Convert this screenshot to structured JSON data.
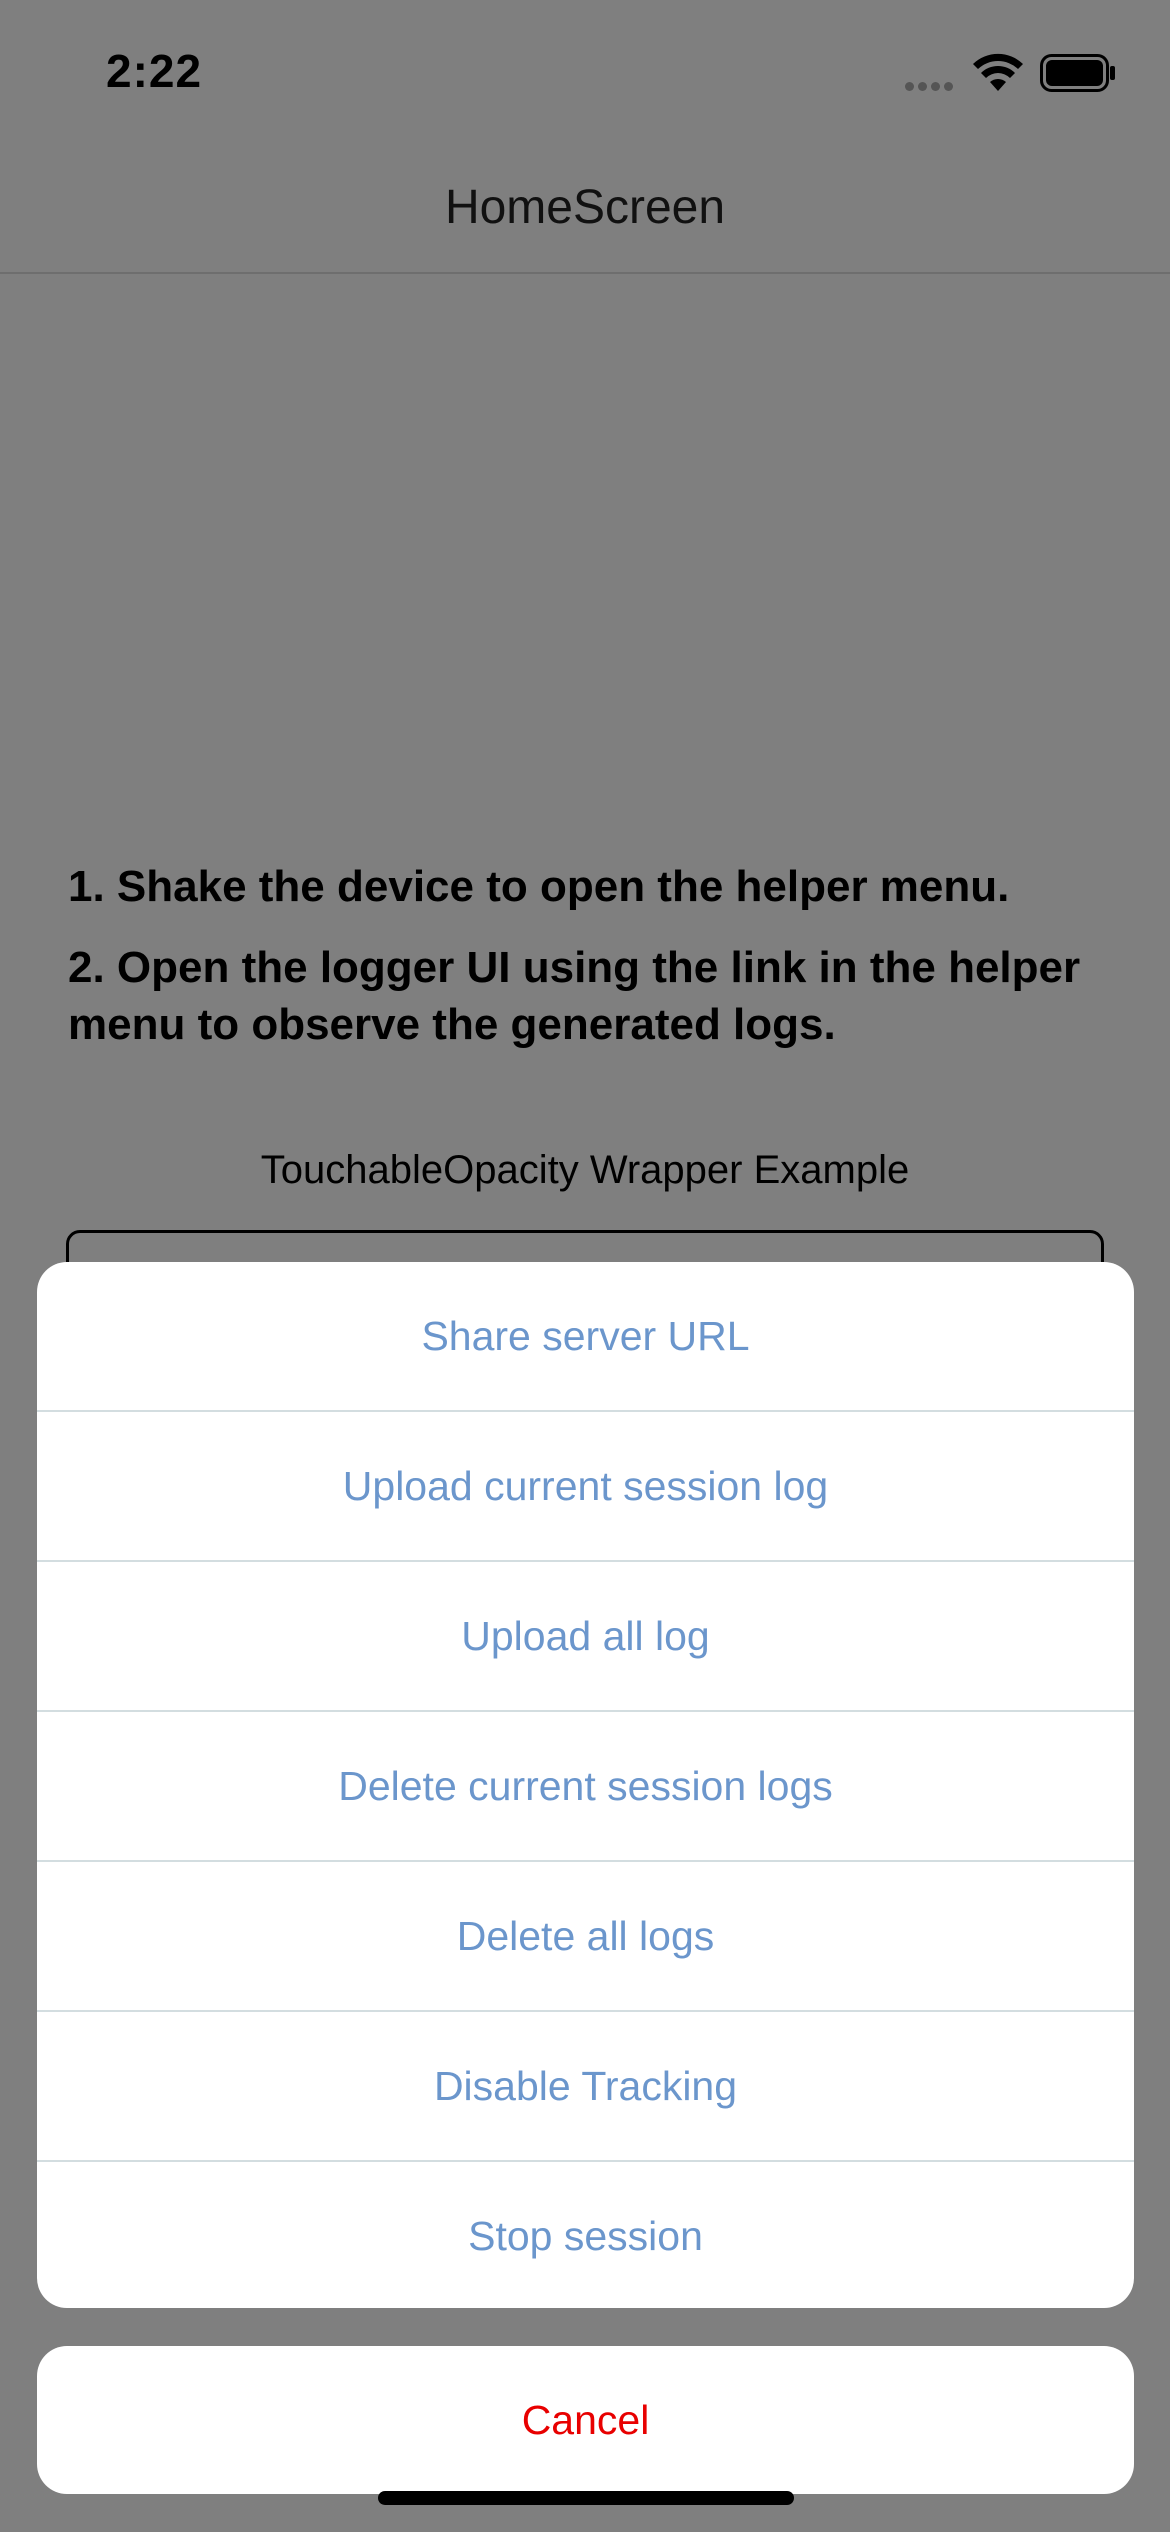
{
  "status_bar": {
    "time": "2:22"
  },
  "header": {
    "title": "HomeScreen"
  },
  "main": {
    "instructions": [
      "1. Shake the device to open the helper menu.",
      "2. Open the logger UI using the link in the helper menu to observe the generated logs."
    ],
    "example_label": "TouchableOpacity Wrapper Example"
  },
  "action_sheet": {
    "items": [
      "Share server URL",
      "Upload current session log",
      "Upload all log",
      "Delete current session logs",
      "Delete all logs",
      "Disable Tracking",
      "Stop session"
    ],
    "cancel_label": "Cancel"
  },
  "colors": {
    "backdrop": "#7f7f7f",
    "action_text": "#6b96cc",
    "cancel_text": "#e80000"
  }
}
